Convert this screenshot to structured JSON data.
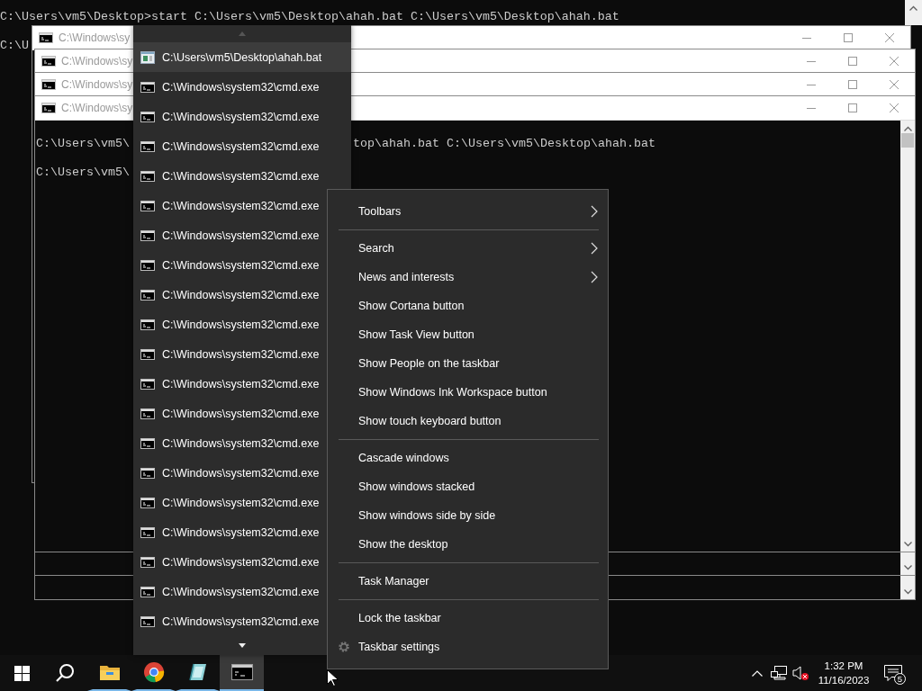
{
  "background_console": {
    "lines": [
      "C:\\Users\\vm5\\Desktop>start C:\\Users\\vm5\\Desktop\\ahah.bat C:\\Users\\vm5\\Desktop\\ahah.bat",
      "C:\\U"
    ]
  },
  "windows": [
    {
      "title": "C:\\Windows\\sy"
    },
    {
      "title": "C:\\Windows\\sy"
    },
    {
      "title": "C:\\Windows\\sy"
    },
    {
      "title": "C:\\Windows\\sy",
      "console_lines": [
        {
          "text": "C:\\Users\\vm5\\",
          "continuation": "top\\ahah.bat C:\\Users\\vm5\\Desktop\\ahah.bat"
        },
        {
          "text": "C:\\Users\\vm5\\"
        }
      ]
    }
  ],
  "jump_list": {
    "items": [
      {
        "kind": "batch",
        "label": "C:\\Users\\vm5\\Desktop\\ahah.bat",
        "selected": true
      },
      {
        "kind": "console",
        "label": "C:\\Windows\\system32\\cmd.exe",
        "selected": false
      },
      {
        "kind": "console",
        "label": "C:\\Windows\\system32\\cmd.exe",
        "selected": false
      },
      {
        "kind": "console",
        "label": "C:\\Windows\\system32\\cmd.exe",
        "selected": false
      },
      {
        "kind": "console",
        "label": "C:\\Windows\\system32\\cmd.exe",
        "selected": false
      },
      {
        "kind": "console",
        "label": "C:\\Windows\\system32\\cmd.exe",
        "selected": false
      },
      {
        "kind": "console",
        "label": "C:\\Windows\\system32\\cmd.exe",
        "selected": false
      },
      {
        "kind": "console",
        "label": "C:\\Windows\\system32\\cmd.exe",
        "selected": false
      },
      {
        "kind": "console",
        "label": "C:\\Windows\\system32\\cmd.exe",
        "selected": false
      },
      {
        "kind": "console",
        "label": "C:\\Windows\\system32\\cmd.exe",
        "selected": false
      },
      {
        "kind": "console",
        "label": "C:\\Windows\\system32\\cmd.exe",
        "selected": false
      },
      {
        "kind": "console",
        "label": "C:\\Windows\\system32\\cmd.exe",
        "selected": false
      },
      {
        "kind": "console",
        "label": "C:\\Windows\\system32\\cmd.exe",
        "selected": false
      },
      {
        "kind": "console",
        "label": "C:\\Windows\\system32\\cmd.exe",
        "selected": false
      },
      {
        "kind": "console",
        "label": "C:\\Windows\\system32\\cmd.exe",
        "selected": false
      },
      {
        "kind": "console",
        "label": "C:\\Windows\\system32\\cmd.exe",
        "selected": false
      },
      {
        "kind": "console",
        "label": "C:\\Windows\\system32\\cmd.exe",
        "selected": false
      },
      {
        "kind": "console",
        "label": "C:\\Windows\\system32\\cmd.exe",
        "selected": false
      },
      {
        "kind": "console",
        "label": "C:\\Windows\\system32\\cmd.exe",
        "selected": false
      },
      {
        "kind": "console",
        "label": "C:\\Windows\\system32\\cmd.exe",
        "selected": false
      }
    ]
  },
  "context_menu": {
    "items": [
      {
        "kind": "submenu",
        "label": "Toolbars"
      },
      {
        "kind": "separator"
      },
      {
        "kind": "submenu",
        "label": "Search"
      },
      {
        "kind": "submenu",
        "label": "News and interests"
      },
      {
        "kind": "item",
        "label": "Show Cortana button"
      },
      {
        "kind": "item",
        "label": "Show Task View button"
      },
      {
        "kind": "item",
        "label": "Show People on the taskbar"
      },
      {
        "kind": "item",
        "label": "Show Windows Ink Workspace button"
      },
      {
        "kind": "item",
        "label": "Show touch keyboard button"
      },
      {
        "kind": "separator"
      },
      {
        "kind": "item",
        "label": "Cascade windows"
      },
      {
        "kind": "item",
        "label": "Show windows stacked"
      },
      {
        "kind": "item",
        "label": "Show windows side by side"
      },
      {
        "kind": "item",
        "label": "Show the desktop"
      },
      {
        "kind": "separator"
      },
      {
        "kind": "item",
        "label": "Task Manager"
      },
      {
        "kind": "separator"
      },
      {
        "kind": "item",
        "label": "Lock the taskbar"
      },
      {
        "kind": "settings",
        "label": "Taskbar settings"
      }
    ]
  },
  "taskbar": {
    "apps": [
      {
        "kind": "folder",
        "running": true,
        "active": false
      },
      {
        "kind": "browser",
        "running": true,
        "active": false
      },
      {
        "kind": "notes",
        "running": true,
        "active": false
      },
      {
        "kind": "console",
        "running": true,
        "active": true
      }
    ],
    "volume_muted": true,
    "clock": {
      "time": "1:32 PM",
      "date": "11/16/2023"
    },
    "notification_count": "5"
  }
}
